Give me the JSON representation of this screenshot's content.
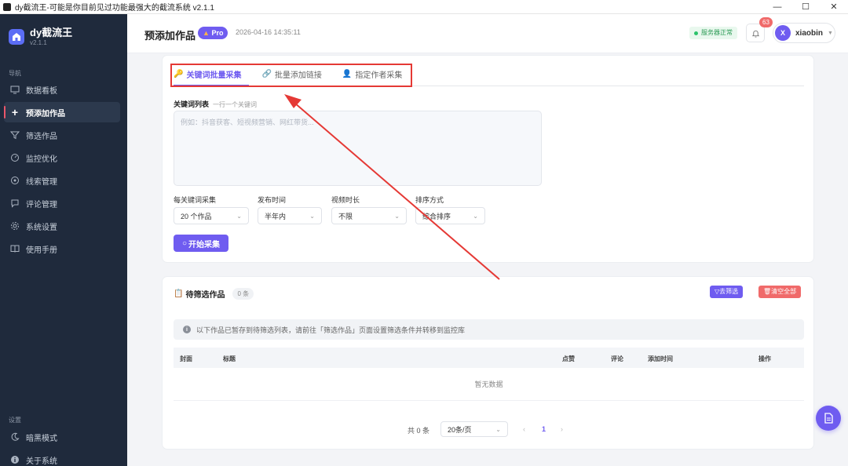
{
  "window": {
    "title": "dy截流王-可能是你目前见过功能最强大的截流系统 v2.1.1",
    "controls": [
      "—",
      "☐",
      "✕"
    ]
  },
  "sidebar": {
    "brand_name": "dy截流王",
    "brand_version": "v2.1.1",
    "nav_section": "导航",
    "items": [
      {
        "label": "数据看板",
        "icon": "monitor-icon"
      },
      {
        "label": "预添加作品",
        "icon": "plus-icon",
        "active": true
      },
      {
        "label": "筛选作品",
        "icon": "filter-icon"
      },
      {
        "label": "监控优化",
        "icon": "gauge-icon"
      },
      {
        "label": "线索管理",
        "icon": "target-icon"
      },
      {
        "label": "评论管理",
        "icon": "comment-icon"
      },
      {
        "label": "系统设置",
        "icon": "gear-icon"
      },
      {
        "label": "使用手册",
        "icon": "book-icon"
      }
    ],
    "settings_section": "设置",
    "settings_items": [
      {
        "label": "暗黑模式",
        "icon": "moon-icon"
      },
      {
        "label": "关于系统",
        "icon": "info-icon"
      }
    ]
  },
  "header": {
    "title": "预添加作品",
    "pro_label": "Pro",
    "datetime": "2026-04-16 14:35:11",
    "server_status": "服务器正常",
    "notif_count": "63",
    "avatar_letter": "X",
    "username": "xiaobin"
  },
  "collect": {
    "tabs": [
      {
        "label": "关键词批量采集",
        "icon": "key-icon",
        "active": true
      },
      {
        "label": "批量添加链接",
        "icon": "link-icon"
      },
      {
        "label": "指定作者采集",
        "icon": "user-icon"
      }
    ],
    "keyword_label": "关键词列表",
    "keyword_hint": "一行一个关键词",
    "keyword_placeholder": "例如：抖音获客、短视频营销、网红带货...",
    "selects": [
      {
        "label": "每关键词采集",
        "value": "20 个作品"
      },
      {
        "label": "发布时间",
        "value": "半年内"
      },
      {
        "label": "视频时长",
        "value": "不限"
      },
      {
        "label": "排序方式",
        "value": "综合排序"
      }
    ],
    "start_button": "开始采集"
  },
  "pending": {
    "title": "待筛选作品",
    "count": "0 条",
    "filter_button": "去筛选",
    "clear_button": "清空全部",
    "info": "以下作品已暂存到待筛选列表，请前往「筛选作品」页面设置筛选条件并转移到监控库",
    "columns": [
      "封面",
      "标题",
      "点赞",
      "评论",
      "添加时间",
      "操作"
    ],
    "empty_text": "暂无数据",
    "total": "共 0 条",
    "page_size": "20条/页",
    "current_page": "1"
  },
  "colors": {
    "accent": "#6f5cf0",
    "sidebar_bg": "#1f2a3c",
    "danger": "#f06a6a",
    "annotation_red": "#e53935"
  }
}
